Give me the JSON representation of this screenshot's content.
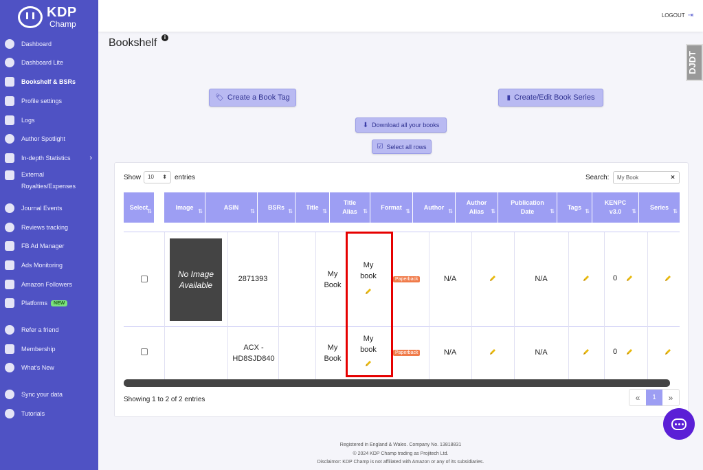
{
  "app": {
    "logo_title": "KDP",
    "logo_sub": "Champ"
  },
  "sidebar": {
    "items": [
      {
        "label": "Dashboard"
      },
      {
        "label": "Dashboard Lite"
      },
      {
        "label": "Bookshelf & BSRs"
      },
      {
        "label": "Profile settings"
      },
      {
        "label": "Logs"
      },
      {
        "label": "Author Spotlight"
      },
      {
        "label": "In-depth Statistics"
      },
      {
        "label": "External Royalties/Expenses"
      },
      {
        "label": "Journal Events"
      },
      {
        "label": "Reviews tracking"
      },
      {
        "label": "FB Ad Manager"
      },
      {
        "label": "Ads Monitoring"
      },
      {
        "label": "Amazon Followers"
      },
      {
        "label": "Platforms",
        "badge": "NEW"
      },
      {
        "label": "Refer a friend"
      },
      {
        "label": "Membership"
      },
      {
        "label": "What's New"
      },
      {
        "label": "Sync your data"
      },
      {
        "label": "Tutorials"
      }
    ]
  },
  "topbar": {
    "logout": "LOGOUT"
  },
  "page": {
    "title": "Bookshelf",
    "side_widget": "DJDT"
  },
  "buttons": {
    "create_tag": "Create a Book Tag",
    "create_series": "Create/Edit Book Series",
    "download": "Download all your books",
    "select_all": "Select all rows"
  },
  "table_controls": {
    "show": "Show",
    "entries_value": "10",
    "entries": "entries",
    "search_label": "Search:",
    "search_value": "My Book"
  },
  "table": {
    "columns": [
      "Select",
      "Image",
      "ASIN",
      "BSRs",
      "Title",
      "Title Alias",
      "Format",
      "Author",
      "Author Alias",
      "Publication Date",
      "Tags",
      "KENPC v3.0",
      "Series"
    ],
    "no_image": "No Image Available",
    "rows": [
      {
        "asin": "2871393",
        "title": "My Book",
        "title_alias": "My book",
        "format": "Paperback",
        "author": "N/A",
        "publication_date": "N/A",
        "kenpc": "0"
      },
      {
        "asin": "ACX - HD8SJD840",
        "title": "My Book",
        "title_alias": "My book",
        "format": "Paperback",
        "author": "N/A",
        "publication_date": "N/A",
        "kenpc": "0"
      }
    ]
  },
  "pagination": {
    "info": "Showing 1 to 2 of 2 entries",
    "prev": "«",
    "current": "1",
    "next": "»"
  },
  "footer": {
    "line1": "Registered in England & Wales. Company No. 13818831",
    "line2": "© 2024 KDP Champ trading as Projitech Ltd.",
    "line3": "Disclaimor: KDP Champ is not affiliated with Amazon or any of its subsidiaries."
  },
  "colors": {
    "sidebar": "#4f52c4",
    "header": "#9d9ef3",
    "button": "#b9baf2",
    "highlight": "#e60000",
    "badge": "#f07b4a",
    "chat": "#5b1fd6"
  }
}
